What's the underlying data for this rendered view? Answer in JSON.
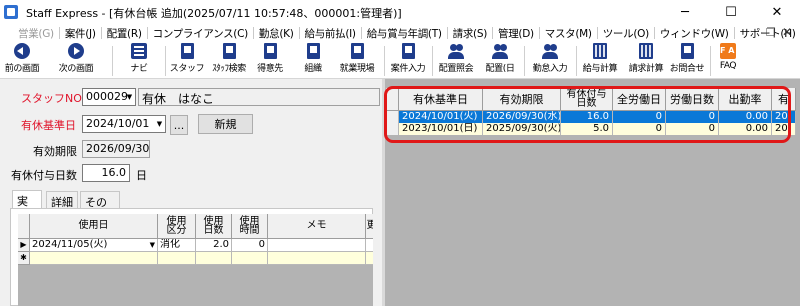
{
  "window": {
    "title": "Staff Express - [有休台帳 追加(2025/07/11 10:57:48、000001:管理者)]",
    "controls": {
      "minimize": "─",
      "maximize": "☐",
      "close": "✕"
    }
  },
  "menu": {
    "items": [
      {
        "label": "営業(G)",
        "disabled": true
      },
      {
        "label": "案件(J)"
      },
      {
        "label": "配置(R)"
      },
      {
        "label": "コンプライアンス(C)"
      },
      {
        "label": "勤怠(K)"
      },
      {
        "label": "給与前払(I)"
      },
      {
        "label": "給与賞与年調(T)"
      },
      {
        "label": "請求(S)"
      },
      {
        "label": "管理(D)"
      },
      {
        "label": "マスタ(M)"
      },
      {
        "label": "ツール(O)"
      },
      {
        "label": "ウィンドウ(W)"
      },
      {
        "label": "サポート(H)"
      }
    ],
    "mdi_restore": "❐",
    "mdi_close": "✕"
  },
  "toolbar": {
    "back": "前の画面",
    "next": "次の画面",
    "navi": "ナビ",
    "staff": "スタッフ",
    "staff_search": "ｽﾀｯﾌ検索",
    "client": "得意先",
    "organization": "組織",
    "workplace": "就業現場",
    "job_entry": "案件入力",
    "placement_inquiry": "配置照会",
    "placement_day": "配置(日",
    "attendance_entry": "勤怠入力",
    "payroll_calc": "給与計算",
    "billing_calc": "請求計算",
    "contact": "お問合せ",
    "faq": "FAQ",
    "faq_icon": "F A Q"
  },
  "form": {
    "staff_no_label": "スタッフNO",
    "staff_no_value": "000029",
    "staff_name": "有休　はなこ",
    "base_date_label": "有休基準日",
    "base_date_value": "2024/10/01",
    "ellipsis_button": "...",
    "new_button": "新規",
    "expiry_label": "有効期限",
    "expiry_value": "2026/09/30",
    "grant_days_label": "有休付与日数",
    "grant_days_value": "16.0",
    "grant_days_unit": "日"
  },
  "tabs": [
    "実績",
    "詳細",
    "その他"
  ],
  "sub_grid": {
    "columns": [
      "使用日",
      "使用\n区分",
      "使用\n日数",
      "使用\n時間",
      "メモ",
      "更"
    ],
    "rows": [
      {
        "marker": "▶",
        "date": "2024/11/05(火)",
        "category": "消化",
        "days": "2.0",
        "hours": "0",
        "memo": ""
      }
    ],
    "new_row_marker": "✱"
  },
  "main_grid": {
    "columns": [
      "有休基準日",
      "有効期限",
      "有休付与\n日数",
      "全労働日",
      "労働日数",
      "出勤率",
      "有"
    ],
    "rows": [
      {
        "base_date": "2024/10/01(火)",
        "expiry": "2026/09/30(水)",
        "grant_days": "16.0",
        "all_work_days": "0",
        "work_days": "0",
        "attendance_rate": "0.00",
        "extra": "20",
        "selected": true
      },
      {
        "base_date": "2023/10/01(日)",
        "expiry": "2025/09/30(火)",
        "grant_days": "5.0",
        "all_work_days": "0",
        "work_days": "0",
        "attendance_rate": "0.00",
        "extra": "20",
        "selected": false
      }
    ]
  },
  "colors": {
    "label_red": "#e0142b",
    "selection_blue": "#0a78d7",
    "highlight_red": "#e01818",
    "new_row_yellow": "#ffffdc"
  }
}
